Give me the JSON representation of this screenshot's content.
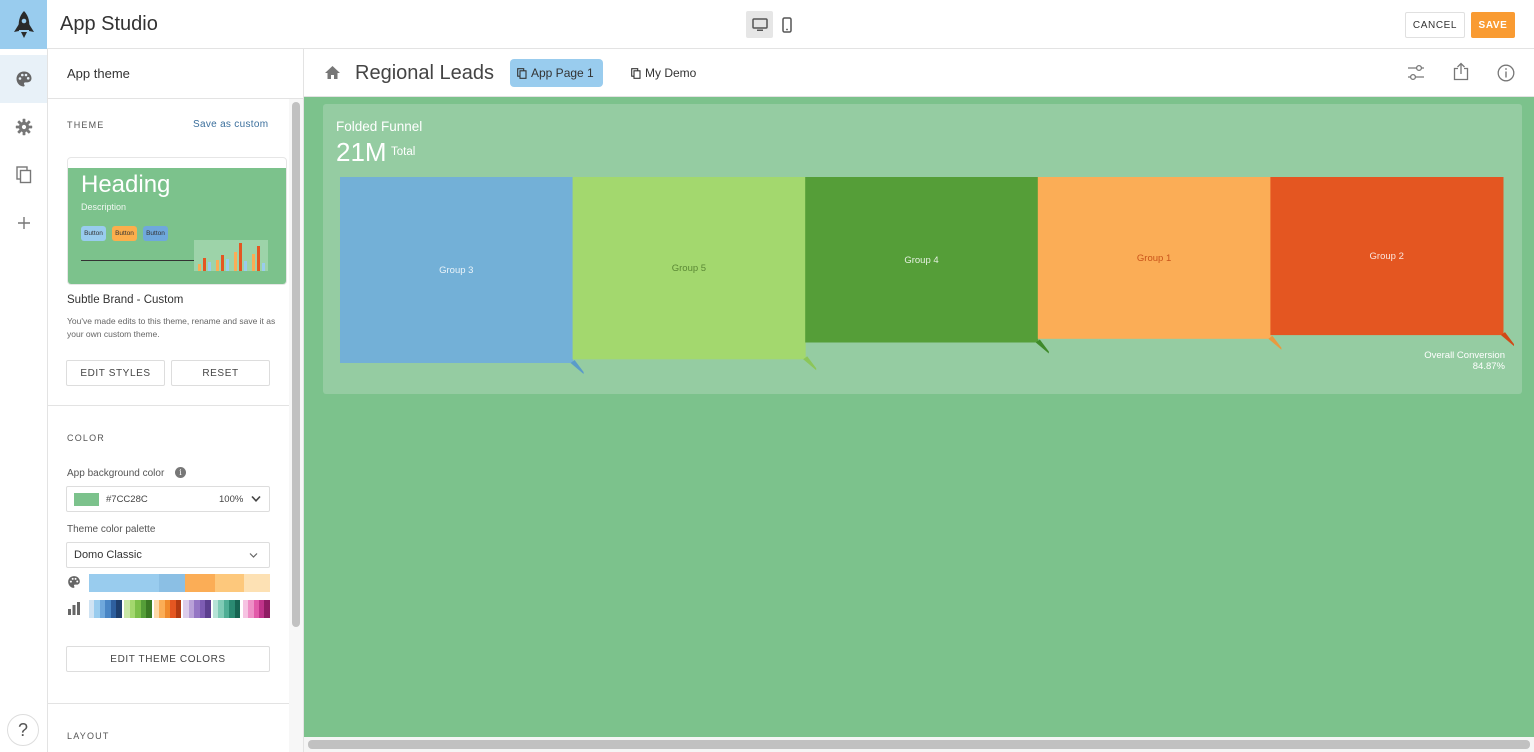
{
  "header": {
    "app_title": "App Studio",
    "cancel_label": "CANCEL",
    "save_label": "SAVE",
    "accent_color": "#f99b32"
  },
  "rail": {
    "items": [
      {
        "icon": "palette-icon",
        "active": true
      },
      {
        "icon": "gear-icon"
      },
      {
        "icon": "copy-pages-icon"
      },
      {
        "icon": "plus-icon"
      }
    ],
    "help_label": "?"
  },
  "panel": {
    "title": "App theme",
    "theme_section_label": "THEME",
    "save_as_custom_label": "Save as custom",
    "preview": {
      "heading": "Heading",
      "description": "Description",
      "buttons": [
        "Button",
        "Button",
        "Button"
      ],
      "button_colors": [
        "#99ccee",
        "#fcae4c",
        "#6fa8dc"
      ]
    },
    "theme_name": "Subtle Brand - Custom",
    "theme_note": "You've made edits to this theme, rename and save it as your own custom theme.",
    "edit_styles_label": "EDIT STYLES",
    "reset_label": "RESET",
    "color_section_label": "COLOR",
    "bg_color_label": "App background color",
    "bg_color_value": "#7CC28C",
    "bg_opacity": "100%",
    "palette_label": "Theme color palette",
    "palette_value": "Domo Classic",
    "edit_theme_colors_label": "EDIT THEME COLORS",
    "layout_section_label": "LAYOUT"
  },
  "canvas": {
    "background_color": "#7cc28c",
    "page_title": "Regional Leads",
    "tabs": [
      {
        "label": "App Page 1",
        "active": true
      },
      {
        "label": "My Demo",
        "active": false
      }
    ],
    "card": {
      "title": "Folded Funnel",
      "total": "21M",
      "total_label": "Total",
      "conversion_label": "Overall Conversion",
      "conversion_value": "84.87%"
    }
  },
  "chart_data": {
    "type": "folded-funnel",
    "title": "Folded Funnel",
    "categories": [
      "Group 3",
      "Group 5",
      "Group 4",
      "Group 1",
      "Group 2"
    ],
    "colors": [
      "#73b0d7",
      "#a3d86e",
      "#559e38",
      "#fbad56",
      "#e45621"
    ],
    "fold_colors": [
      "#5a9bc9",
      "#8cc659",
      "#3f8a2a",
      "#e89a3f",
      "#d04a18"
    ],
    "relative_heights": [
      1.0,
      0.98,
      0.89,
      0.87,
      0.85
    ],
    "total": "21M",
    "overall_conversion": "84.87%"
  }
}
